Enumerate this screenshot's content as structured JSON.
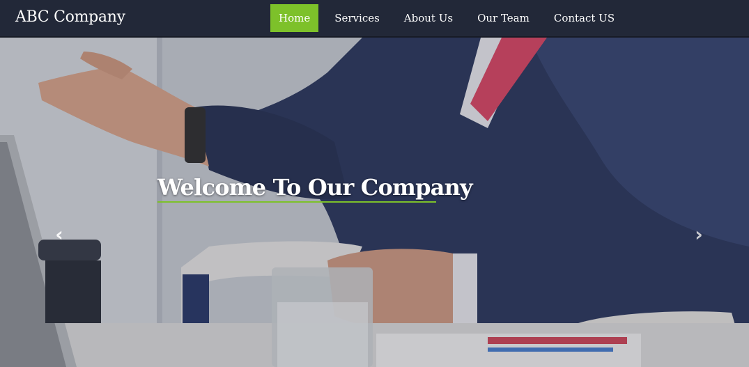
{
  "navbar": {
    "brand": "ABC Company",
    "items": [
      {
        "label": "Home",
        "active": true
      },
      {
        "label": "Services",
        "active": false
      },
      {
        "label": "About Us",
        "active": false
      },
      {
        "label": "Our Team",
        "active": false
      },
      {
        "label": "Contact US",
        "active": false
      }
    ]
  },
  "hero": {
    "headline": "Welcome To Our Company",
    "prev_icon": "chevron-left-icon",
    "next_icon": "chevron-right-icon",
    "prev_glyph": "‹",
    "next_glyph": "›"
  },
  "colors": {
    "navbar_bg": "#222838",
    "accent": "#7dc12a",
    "text": "#ffffff"
  }
}
